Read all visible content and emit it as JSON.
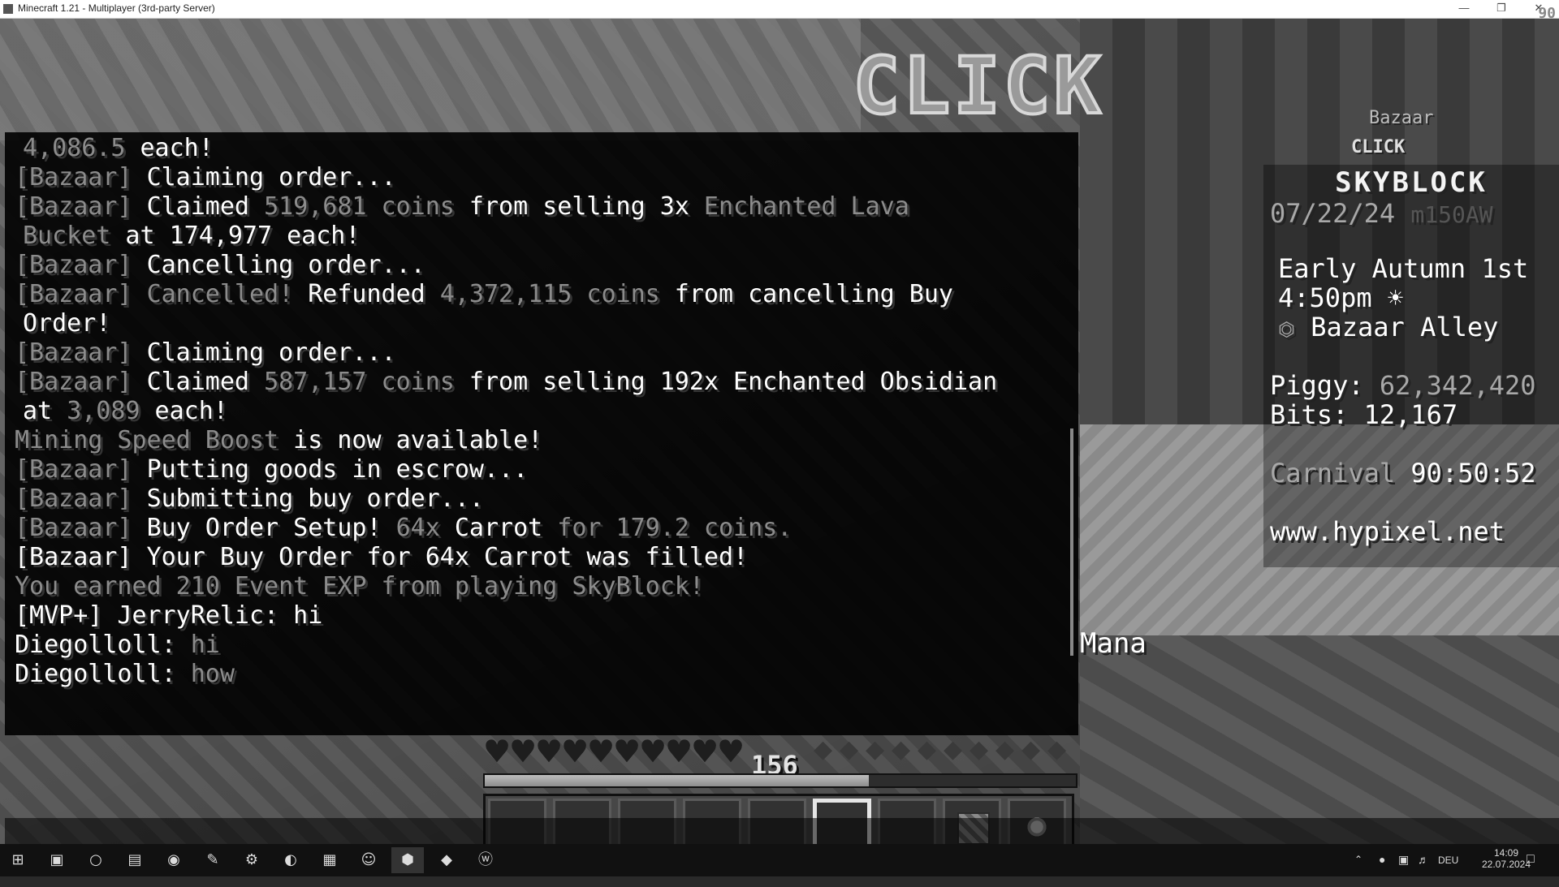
{
  "window": {
    "title": "Minecraft 1.21 - Multiplayer (3rd-party Server)",
    "fps": "90",
    "minimize_glyph": "—",
    "restore_glyph": "❐",
    "close_glyph": "✕"
  },
  "world": {
    "sign_text": "CLICK"
  },
  "chat": {
    "lines": [
      [
        {
          "t": "4,086.5 ",
          "c": "g"
        },
        {
          "t": "each!",
          "c": "w"
        }
      ],
      [
        {
          "t": "[Bazaar] ",
          "c": "g"
        },
        {
          "t": "Claiming order...",
          "c": "w"
        }
      ],
      [
        {
          "t": "[Bazaar] ",
          "c": "g"
        },
        {
          "t": "Claimed ",
          "c": "w"
        },
        {
          "t": "519,681 coins",
          "c": "g"
        },
        {
          "t": " from selling 3x ",
          "c": "w"
        },
        {
          "t": "Enchanted Lava",
          "c": "g"
        }
      ],
      [
        {
          "t": "Bucket",
          "c": "g"
        },
        {
          "t": " at 174,977 each!",
          "c": "w"
        }
      ],
      [
        {
          "t": "[Bazaar] ",
          "c": "g"
        },
        {
          "t": "Cancelling order...",
          "c": "w"
        }
      ],
      [
        {
          "t": "[Bazaar] ",
          "c": "g"
        },
        {
          "t": "Cancelled!",
          "c": "g"
        },
        {
          "t": " Refunded ",
          "c": "w"
        },
        {
          "t": "4,372,115 coins",
          "c": "g"
        },
        {
          "t": " from cancelling Buy",
          "c": "w"
        }
      ],
      [
        {
          "t": "Order!",
          "c": "w"
        }
      ],
      [
        {
          "t": "[Bazaar] ",
          "c": "g"
        },
        {
          "t": "Claiming order...",
          "c": "w"
        }
      ],
      [
        {
          "t": "[Bazaar] ",
          "c": "g"
        },
        {
          "t": "Claimed ",
          "c": "w"
        },
        {
          "t": "587,157 coins",
          "c": "g"
        },
        {
          "t": " from selling 192x Enchanted Obsidian",
          "c": "w"
        }
      ],
      [
        {
          "t": "at ",
          "c": "w"
        },
        {
          "t": "3,089",
          "c": "g"
        },
        {
          "t": " each!",
          "c": "w"
        }
      ],
      [
        {
          "t": "Mining Speed Boost",
          "c": "g"
        },
        {
          "t": " is now available!",
          "c": "w"
        }
      ],
      [
        {
          "t": "[Bazaar] ",
          "c": "g"
        },
        {
          "t": "Putting goods in escrow...",
          "c": "w"
        }
      ],
      [
        {
          "t": "[Bazaar] ",
          "c": "g"
        },
        {
          "t": "Submitting buy order...",
          "c": "w"
        }
      ],
      [
        {
          "t": "[Bazaar] ",
          "c": "g"
        },
        {
          "t": "Buy Order Setup! ",
          "c": "w"
        },
        {
          "t": "64x ",
          "c": "g"
        },
        {
          "t": "Carrot",
          "c": "w"
        },
        {
          "t": " for ",
          "c": "g"
        },
        {
          "t": "179.2 coins.",
          "c": "g"
        }
      ],
      [
        {
          "t": "[Bazaar] Your Buy Order for 64x Carrot was filled!",
          "c": "w"
        }
      ],
      [
        {
          "t": "You earned 210 Event EXP from playing SkyBlock!",
          "c": "g"
        }
      ],
      [
        {
          "t": "[MVP+] JerryRelic: hi",
          "c": "w"
        }
      ],
      [
        {
          "t": "Diegolloll: ",
          "c": "w"
        },
        {
          "t": "hi",
          "c": "g"
        }
      ],
      [
        {
          "t": "Diegolloll: ",
          "c": "w"
        },
        {
          "t": "how",
          "c": "g"
        }
      ]
    ]
  },
  "scoreboard": {
    "above_label": "Bazaar",
    "above_label2": "CLICK",
    "title": "SKYBLOCK",
    "date": "07/22/24",
    "server": "m150AW",
    "season": "Early Autumn 1st",
    "time": "4:50pm ☀",
    "location_icon": "⏣",
    "location": "Bazaar Alley",
    "piggy_label": "Piggy: ",
    "piggy_value": "62,342,420",
    "bits_label": "Bits: ",
    "bits_value": "12,167",
    "event_label": "Carnival ",
    "event_value": "90:50:52",
    "website": "www.hypixel.net"
  },
  "hud": {
    "mana_label": "Mana",
    "level": "156",
    "hearts_total": 10,
    "hearts_full": 10,
    "food_total": 10,
    "xp_progress": 0.65,
    "hotbar_selected_slot": 5,
    "hotbar_items": [
      "",
      "",
      "",
      "",
      "",
      "",
      "",
      "compactor",
      "star"
    ]
  },
  "taskbar": {
    "icons": [
      "windows-start",
      "task-view",
      "cortana",
      "file-explorer",
      "browser-chrome",
      "notepad",
      "steam",
      "edge",
      "store",
      "discord",
      "vscode",
      "minecraft",
      "word"
    ],
    "active": "vscode",
    "language": "DEU",
    "time": "14:09",
    "date": "22.07.2024"
  }
}
